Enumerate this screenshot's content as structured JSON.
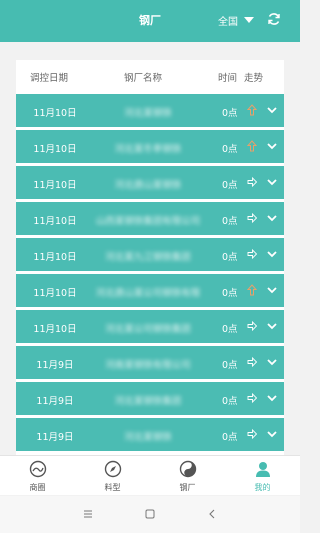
{
  "header": {
    "title": "钢厂",
    "region_label": "全国"
  },
  "table": {
    "headers": {
      "date": "调控日期",
      "name": "钢厂名称",
      "time": "时间",
      "trend": "走势"
    },
    "rows": [
      {
        "date": "11月10日",
        "name": "河北某钢铁",
        "time": "0点",
        "trend": "up"
      },
      {
        "date": "11月10日",
        "name": "河北某冬季钢铁",
        "time": "0点",
        "trend": "up"
      },
      {
        "date": "11月10日",
        "name": "河北唐山某钢铁",
        "time": "0点",
        "trend": "right"
      },
      {
        "date": "11月10日",
        "name": "山西某钢铁集团有限公司",
        "time": "0点",
        "trend": "right"
      },
      {
        "date": "11月10日",
        "name": "河北某九江钢铁集团",
        "time": "0点",
        "trend": "right"
      },
      {
        "date": "11月10日",
        "name": "河北唐山某公司钢铁有限",
        "time": "0点",
        "trend": "up"
      },
      {
        "date": "11月10日",
        "name": "河北某公司钢铁集团",
        "time": "0点",
        "trend": "right"
      },
      {
        "date": "11月9日",
        "name": "河南某钢铁有限公司",
        "time": "0点",
        "trend": "right"
      },
      {
        "date": "11月9日",
        "name": "河北某钢铁集团",
        "time": "0点",
        "trend": "right"
      },
      {
        "date": "11月9日",
        "name": "河北某钢铁",
        "time": "0点",
        "trend": "right"
      }
    ]
  },
  "tabs": [
    {
      "label": "商圈",
      "icon": "circle-map-icon"
    },
    {
      "label": "料型",
      "icon": "compass-icon"
    },
    {
      "label": "钢厂",
      "icon": "yin-yang-icon"
    },
    {
      "label": "我的",
      "icon": "user-icon",
      "active": true
    }
  ],
  "colors": {
    "accent": "#47bcb1",
    "row": "#4bbcb3"
  }
}
